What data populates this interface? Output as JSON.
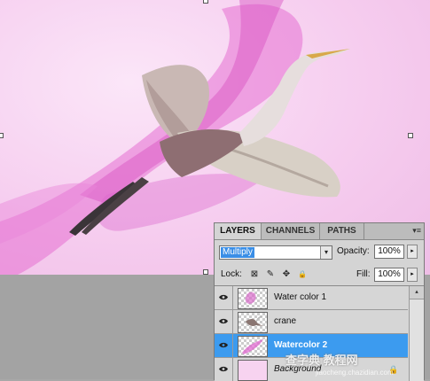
{
  "panel": {
    "tabs": [
      {
        "label": "LAYERS",
        "active": true
      },
      {
        "label": "CHANNELS",
        "active": false
      },
      {
        "label": "PATHS",
        "active": false
      }
    ],
    "menu_glyph": "▾≡",
    "blend_mode": "Multiply",
    "opacity_label": "Opacity:",
    "opacity_value": "100%",
    "lock_label": "Lock:",
    "fill_label": "Fill:",
    "fill_value": "100%"
  },
  "layers": [
    {
      "name": "Water color 1",
      "visible": true,
      "selected": false,
      "thumb": "watercolor"
    },
    {
      "name": "crane",
      "visible": true,
      "selected": false,
      "thumb": "crane"
    },
    {
      "name": "Watercolor 2",
      "visible": true,
      "selected": true,
      "thumb": "watercolor"
    },
    {
      "name": "Background",
      "visible": true,
      "selected": false,
      "thumb": "pink",
      "locked": true
    }
  ],
  "icons": {
    "blend_arrow": "▾",
    "stepper_arrow": "▸",
    "scroll_up": "▴",
    "lock_transparent": "⊠",
    "lock_image": "✎",
    "lock_position": "✥",
    "lock_all": "🔒"
  },
  "colors": {
    "canvas_pink": "#f6cdef",
    "selection_blue": "#3c9bef",
    "panel_gray": "#d4d4d4"
  },
  "watermark": {
    "text": "查字典 教程网",
    "url": "jiaocheng.chazidian.com"
  }
}
